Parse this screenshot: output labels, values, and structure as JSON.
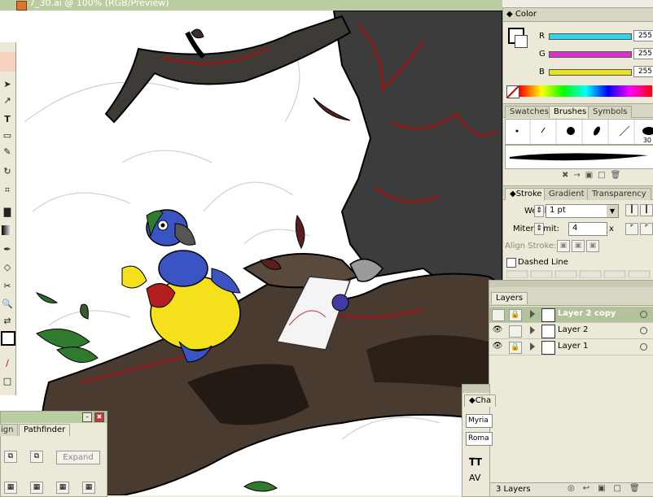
{
  "document": {
    "title": "7_30.ai @ 100% (RGB/Preview)"
  },
  "colors": {
    "panel_bg": "#ece9d8",
    "title_bar": "#b9cda0",
    "selected_layer": "#b2c39b",
    "r_slider": "#35d2e6",
    "g_slider": "#d437c9",
    "b_slider": "#e6e22a"
  },
  "color_panel": {
    "title": "Color",
    "r_label": "R",
    "g_label": "G",
    "b_label": "B",
    "r_value": "255",
    "g_value": "255",
    "b_value": "255"
  },
  "brushes_panel": {
    "tabs": [
      "Swatches",
      "Brushes",
      "Symbols"
    ],
    "brush_size_label": "30"
  },
  "stroke_panel": {
    "tabs": [
      "Stroke",
      "Gradient",
      "Transparency"
    ],
    "weight_label": "Weight:",
    "weight_value": "1 pt",
    "miter_label": "Miter Limit:",
    "miter_value": "4",
    "miter_unit": "x",
    "align_label": "Align Stroke:",
    "dashed_label": "Dashed Line"
  },
  "layers_panel": {
    "title": "Layers",
    "layers": [
      {
        "name": "Layer 2 copy",
        "selected": true
      },
      {
        "name": "Layer 2",
        "selected": false
      },
      {
        "name": "Layer 1",
        "selected": false
      }
    ],
    "footer": "3 Layers"
  },
  "pathfinder_panel": {
    "tabs": [
      "ign",
      "Pathfinder"
    ],
    "expand_label": "Expand"
  },
  "character_panel": {
    "tab": "Cha",
    "font_label": "Myria",
    "style_label": "Roma"
  },
  "toolbox": {
    "icons": [
      "selection-icon",
      "direct-select-icon",
      "pen-icon",
      "type-icon",
      "rectangle-icon",
      "brush-icon",
      "rotate-icon",
      "scale-icon",
      "warp-icon",
      "graph-icon",
      "gradient-icon",
      "eyedropper-icon",
      "blend-icon",
      "scissors-icon",
      "zoom-icon",
      "swap-icon"
    ]
  }
}
